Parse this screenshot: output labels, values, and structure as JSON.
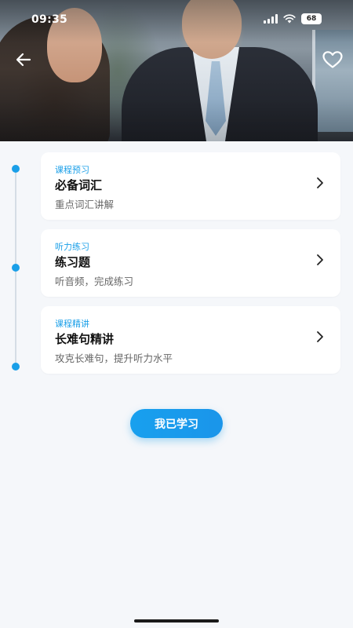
{
  "status_bar": {
    "time": "09:35",
    "battery": "68"
  },
  "colors": {
    "accent": "#1a9fe8",
    "background": "#f5f7fa",
    "card": "#ffffff"
  },
  "header": {
    "back_icon": "arrow-left-icon",
    "favorite_icon": "heart-outline-icon"
  },
  "lessons": [
    {
      "tag": "课程预习",
      "title": "必备词汇",
      "desc": "重点词汇讲解"
    },
    {
      "tag": "听力练习",
      "title": "练习题",
      "desc": "听音频，完成练习"
    },
    {
      "tag": "课程精讲",
      "title": "长难句精讲",
      "desc": "攻克长难句，提升听力水平"
    }
  ],
  "actions": {
    "learned_label": "我已学习"
  }
}
